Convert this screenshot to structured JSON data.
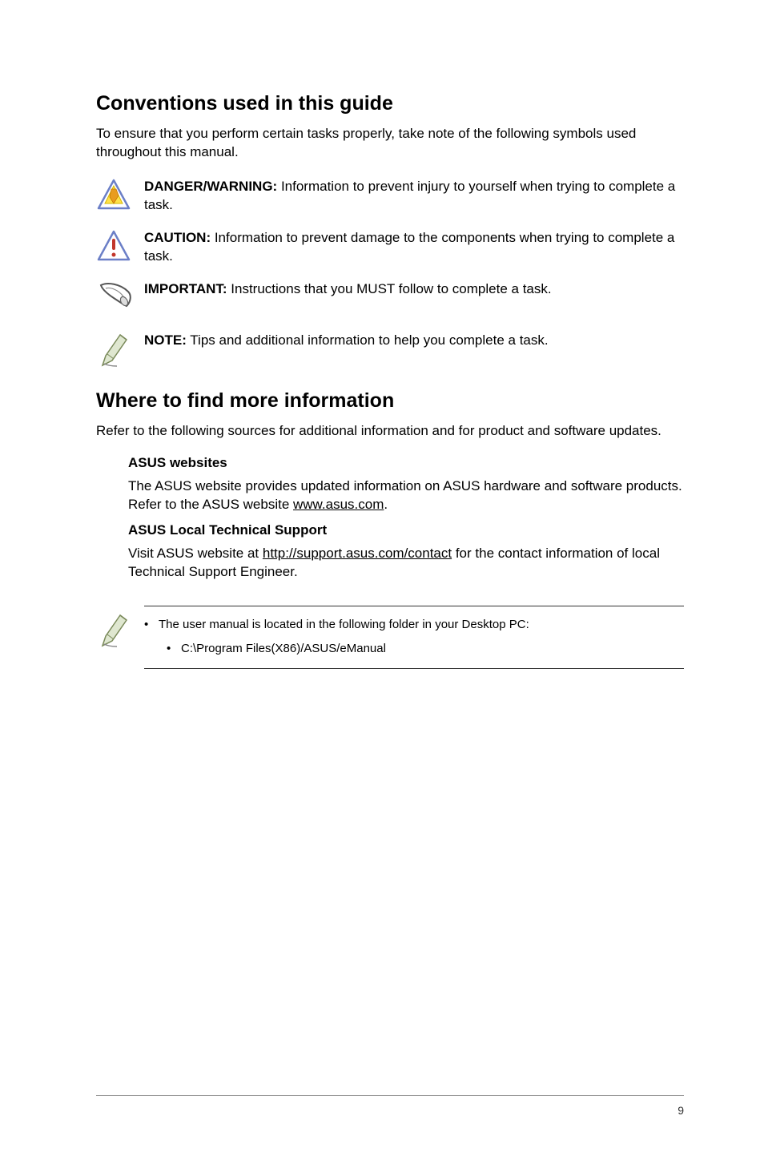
{
  "section1": {
    "title": "Conventions used in this guide",
    "intro": "To ensure that you perform certain tasks properly, take note of the following symbols used throughout this manual.",
    "items": [
      {
        "label": "DANGER/WARNING:",
        "text": " Information to prevent injury to yourself when trying to complete a task."
      },
      {
        "label": "CAUTION:",
        "text": " Information to prevent damage to the components when trying to complete a task."
      },
      {
        "label": "IMPORTANT:",
        "text": " Instructions that you MUST follow to complete a task."
      },
      {
        "label": "NOTE:",
        "text": " Tips and additional information to help you complete a task."
      }
    ]
  },
  "section2": {
    "title": "Where to find more information",
    "intro": "Refer to the following sources for additional information and for product and software updates.",
    "asus_websites": {
      "heading": "ASUS websites",
      "text_before": "The ASUS website provides updated information on ASUS hardware and software products. Refer to the ASUS website ",
      "link": "www.asus.com",
      "text_after": "."
    },
    "asus_support": {
      "heading": "ASUS Local Technical Support",
      "text_before": "Visit ASUS website at ",
      "link": "http://support.asus.com/contact",
      "text_after": " for the contact information of local Technical Support Engineer."
    }
  },
  "note_box": {
    "line1": "The user manual is located in the following folder in your Desktop PC:",
    "line2": "C:\\Program Files(X86)/ASUS/eManual"
  },
  "page_number": "9"
}
